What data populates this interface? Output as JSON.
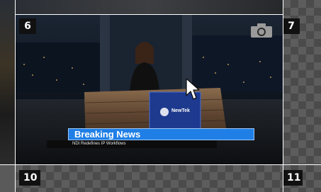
{
  "tiles": {
    "top_left": {
      "number": "6"
    },
    "top_right": {
      "number": "7"
    },
    "bottom_left": {
      "number": "10"
    },
    "bottom_right": {
      "number": "11"
    }
  },
  "program": {
    "lower_third": {
      "headline": "Breaking News",
      "subline": "NDI Redefines IP Workflows"
    },
    "desk_logo": "NewTek"
  },
  "icons": {
    "snapshot": "camera-icon",
    "cursor": "mouse-pointer-icon"
  },
  "colors": {
    "tile_number_bg": "#111111",
    "lower_third_accent": "#1f7fe6",
    "checker_light": "#5d5d5d",
    "checker_dark": "#4b4b4b"
  }
}
